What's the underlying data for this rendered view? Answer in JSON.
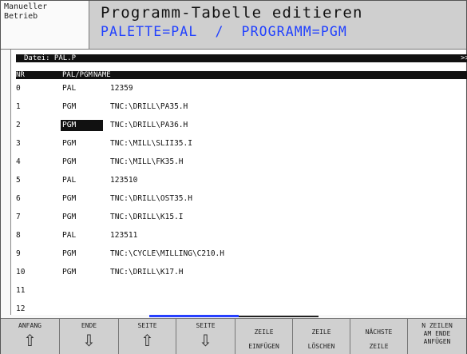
{
  "mode": {
    "line1": "Manueller",
    "line2": "Betrieb"
  },
  "title": "Programm-Tabelle editieren",
  "subtitle": "PALETTE=PAL  /  PROGRAMM=PGM",
  "file": {
    "label": "Datei: PAL.P",
    "marker": ">>"
  },
  "columns": {
    "nr": "NR",
    "typ": "PAL/PGM",
    "name": "NAME"
  },
  "rows": [
    {
      "nr": "0",
      "typ": "PAL",
      "name": "12359"
    },
    {
      "nr": "1",
      "typ": "PGM",
      "name": "TNC:\\DRILL\\PA35.H"
    },
    {
      "nr": "2",
      "typ": "PGM",
      "name": "TNC:\\DRILL\\PA36.H"
    },
    {
      "nr": "3",
      "typ": "PGM",
      "name": "TNC:\\MILL\\SLII35.I"
    },
    {
      "nr": "4",
      "typ": "PGM",
      "name": "TNC:\\MILL\\FK35.H"
    },
    {
      "nr": "5",
      "typ": "PAL",
      "name": "123510"
    },
    {
      "nr": "6",
      "typ": "PGM",
      "name": "TNC:\\DRILL\\OST35.H"
    },
    {
      "nr": "7",
      "typ": "PGM",
      "name": "TNC:\\DRILL\\K15.I"
    },
    {
      "nr": "8",
      "typ": "PAL",
      "name": "123511"
    },
    {
      "nr": "9",
      "typ": "PGM",
      "name": "TNC:\\CYCLE\\MILLING\\C210.H"
    },
    {
      "nr": "10",
      "typ": "PGM",
      "name": "TNC:\\DRILL\\K17.H"
    },
    {
      "nr": "11",
      "typ": "",
      "name": ""
    },
    {
      "nr": "12",
      "typ": "",
      "name": ""
    }
  ],
  "softkeys": {
    "anfang": {
      "top": "ANFANG",
      "arrow": "⇧"
    },
    "ende": {
      "top": "ENDE",
      "arrow": "⇩"
    },
    "seite_up": {
      "top": "SEITE",
      "arrow": "⇧"
    },
    "seite_down": {
      "top": "SEITE",
      "arrow": "⇩"
    },
    "zeile_einfuegen": {
      "line1": "ZEILE",
      "line2": "EINFÜGEN"
    },
    "zeile_loeschen": {
      "line1": "ZEILE",
      "line2": "LÖSCHEN"
    },
    "naechste_zeile": {
      "line1": "NÄCHSTE",
      "line2": "ZEILE"
    },
    "n_zeilen": {
      "line1": "N ZEILEN",
      "line2": "AM ENDE",
      "line3": "ANFÜGEN"
    }
  }
}
